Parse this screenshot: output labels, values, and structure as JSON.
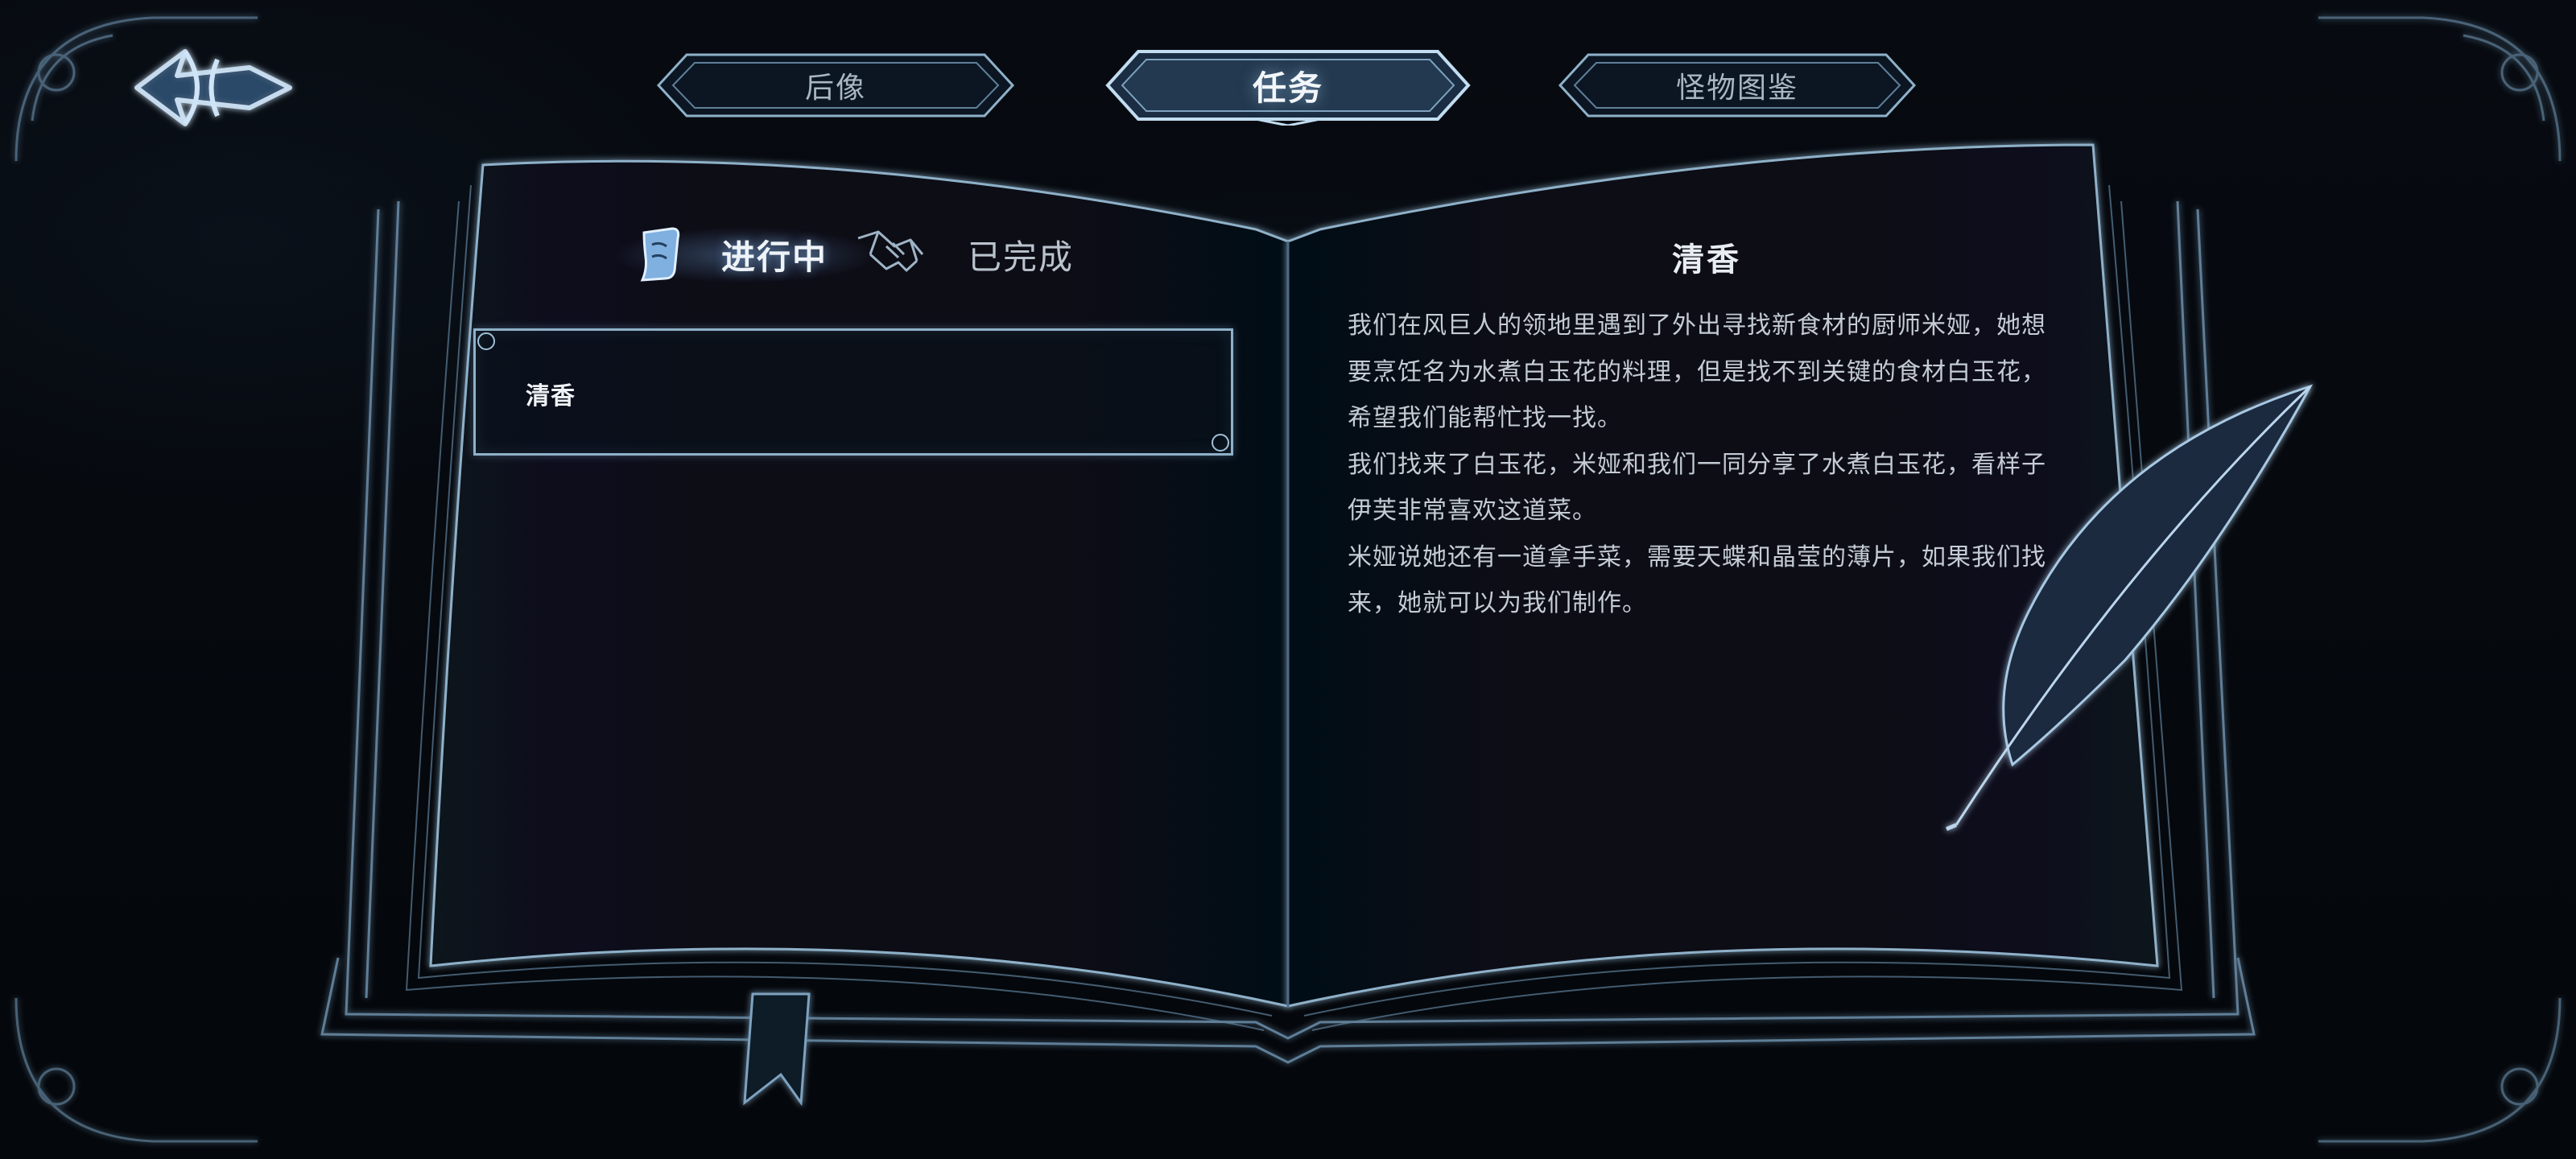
{
  "tabs": [
    {
      "label": "后像",
      "active": false
    },
    {
      "label": "任务",
      "active": true
    },
    {
      "label": "怪物图鉴",
      "active": false
    }
  ],
  "quest_filters": {
    "ongoing": "进行中",
    "completed": "已完成"
  },
  "quest_list": [
    {
      "title": "清香",
      "selected": true
    }
  ],
  "quest_detail": {
    "title": "清香",
    "paragraphs": [
      "我们在风巨人的领地里遇到了外出寻找新食材的厨师米娅，她想要烹饪名为水煮白玉花的料理，但是找不到关键的食材白玉花，希望我们能帮忙找一找。",
      "我们找来了白玉花，米娅和我们一同分享了水煮白玉花，看样子伊芙非常喜欢这道菜。",
      "米娅说她还有一道拿手菜，需要天蝶和晶莹的薄片，如果我们找来，她就可以为我们制作。"
    ]
  },
  "icons": {
    "back": "back-arrow-icon",
    "ongoing": "scroll-icon",
    "completed": "handshake-icon",
    "decor": "quill-icon"
  },
  "colors": {
    "background": "#05080d",
    "line_glow": "#8fb1c9",
    "text_primary": "#eef3f8",
    "text_secondary": "#c4ccd4"
  }
}
